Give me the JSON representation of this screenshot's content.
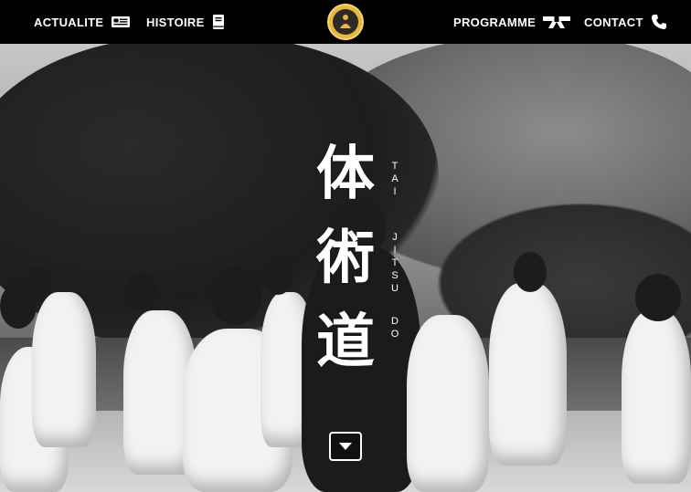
{
  "nav": {
    "left": [
      {
        "label": "ACTUALITE",
        "icon": "newspaper-icon"
      },
      {
        "label": "HISTOIRE",
        "icon": "book-icon"
      }
    ],
    "right": [
      {
        "label": "PROGRAMME",
        "icon": "belt-icon"
      },
      {
        "label": "CONTACT",
        "icon": "phone-icon"
      }
    ],
    "logo_icon": "meditating-figure-logo"
  },
  "hero": {
    "kanji": [
      "体",
      "術",
      "道"
    ],
    "romaji_line1": [
      "T",
      "A",
      "I"
    ],
    "romaji_line2": [
      "J",
      "I",
      "T",
      "S",
      "U",
      "D",
      "O"
    ],
    "scroll_icon": "caret-down-icon"
  },
  "colors": {
    "nav_bg": "#000000",
    "text": "#ffffff",
    "logo_gold": "#e9b73a"
  }
}
